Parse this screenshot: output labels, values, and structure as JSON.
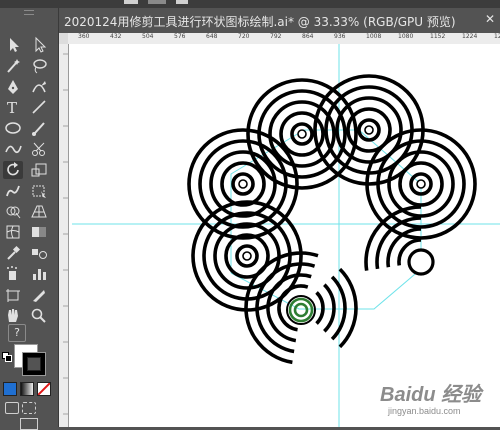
{
  "document": {
    "title": "2020124用修剪工具进行环状图标绘制.ai* @ 33.33% (RGB/GPU 预览)",
    "close_glyph": "✕"
  },
  "ruler": {
    "ticks": [
      "360",
      "432",
      "504",
      "576",
      "648",
      "720",
      "792",
      "864",
      "936",
      "1008",
      "1080",
      "1152",
      "1224",
      "12"
    ]
  },
  "tools": [
    "selection-tool-icon",
    "direct-selection-tool-icon",
    "magic-wand-tool-icon",
    "lasso-tool-icon",
    "pen-tool-icon",
    "curvature-tool-icon",
    "type-tool-icon",
    "line-segment-tool-icon",
    "ellipse-tool-icon",
    "paintbrush-tool-icon",
    "shaper-tool-icon",
    "scissors-tool-icon",
    "rotate-tool-icon",
    "scale-tool-icon",
    "warp-tool-icon",
    "free-transform-tool-icon",
    "shape-builder-tool-icon",
    "perspective-grid-tool-icon",
    "mesh-tool-icon",
    "gradient-tool-icon",
    "eyedropper-tool-icon",
    "blend-tool-icon",
    "symbol-sprayer-tool-icon",
    "column-graph-tool-icon",
    "artboard-tool-icon",
    "slice-tool-icon",
    "hand-tool-icon",
    "zoom-tool-icon"
  ],
  "toolbar_extras": {
    "help_glyph": "?",
    "fill_stroke": "fill-stroke-swatches",
    "color_modes": [
      "color-mode-icon",
      "gradient-mode-icon",
      "none-mode-icon"
    ],
    "drawing_modes": [
      "draw-normal-icon",
      "draw-behind-icon"
    ],
    "screen_mode": "screen-mode-icon"
  },
  "colors": {
    "ui_bg": "#535353",
    "canvas": "#ffffff",
    "guide": "#6fe3ea",
    "stroke": "#000000",
    "selection": "#2e7d32"
  },
  "watermark": {
    "main": "Baidu 经验",
    "sub": "jingyan.baidu.com"
  }
}
